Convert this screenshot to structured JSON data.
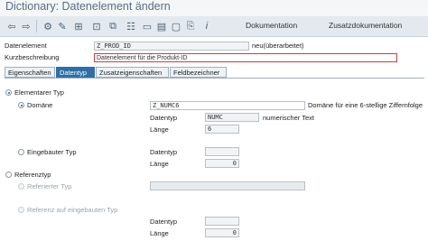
{
  "window": {
    "title": "Dictionary: Datenelement ändern"
  },
  "toolbar": {
    "documentation_label": "Dokumentation",
    "supplementary_doc_label": "Zusatzdokumentation",
    "icons": [
      "back-arrow-icon",
      "forward-arrow-icon",
      "other-object-icon",
      "display-change-icon",
      "activate-icon",
      "check-icon",
      "where-used-icon",
      "object-list-icon",
      "navigate-icon",
      "hierarchy-icon",
      "window-icon",
      "info-icon"
    ]
  },
  "header": {
    "data_element_label": "Datenelement",
    "data_element_value": "Z_PROD_ID",
    "status_text": "neu(überarbeitet)",
    "short_desc_label": "Kurzbeschreibung",
    "short_desc_value": "Datenelement für die Produkt-ID"
  },
  "tabs": [
    {
      "label": "Eigenschaften",
      "active": false
    },
    {
      "label": "Datentyp",
      "active": true
    },
    {
      "label": "Zusatzeigenschaften",
      "active": false
    },
    {
      "label": "Feldbezeichner",
      "active": false
    }
  ],
  "elementary": {
    "radio_label": "Elementarer Typ",
    "selected": true,
    "domain": {
      "radio_label": "Domäne",
      "selected": true,
      "value": "Z_NUMC6",
      "description": "Domäne für eine 6-stellige Ziffernfolge",
      "datatype_label": "Datentyp",
      "datatype_value": "NUMC",
      "datatype_text": "numerischer Text",
      "length_label": "Länge",
      "length_value": "6"
    },
    "builtin": {
      "radio_label": "Eingebauter Typ",
      "selected": false,
      "datatype_label": "Datentyp",
      "datatype_value": "",
      "length_label": "Länge",
      "length_value": "0"
    }
  },
  "reference": {
    "radio_label": "Referenztyp",
    "selected": false,
    "referenced_type_label": "Referierter Typ",
    "referenced_type_value": "",
    "builtin_ref_label": "Referenz auf eingebauten Typ",
    "datatype_label": "Datentyp",
    "datatype_value": "",
    "length_label": "Länge",
    "length_value": "0"
  },
  "colors": {
    "accent": "#2f6fa8",
    "title": "#5a6e84",
    "edit_border": "#c94040"
  }
}
